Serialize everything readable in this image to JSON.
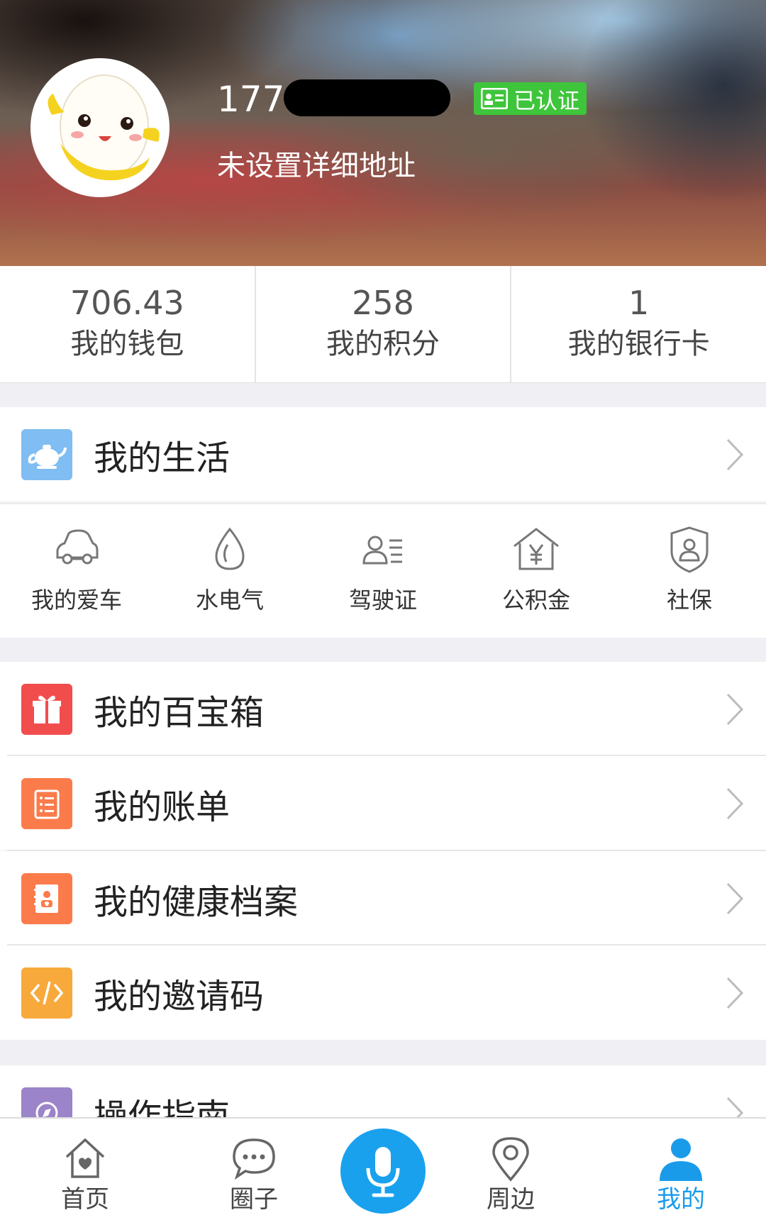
{
  "profile": {
    "phone_prefix": "177",
    "verified_label": "已认证",
    "address": "未设置详细地址"
  },
  "stats": [
    {
      "value": "706.43",
      "label": "我的钱包"
    },
    {
      "value": "258",
      "label": "我的积分"
    },
    {
      "value": "1",
      "label": "我的银行卡"
    }
  ],
  "life": {
    "title": "我的生活",
    "items": [
      {
        "label": "我的爱车",
        "icon": "car-icon"
      },
      {
        "label": "水电气",
        "icon": "water-drop-icon"
      },
      {
        "label": "驾驶证",
        "icon": "license-icon"
      },
      {
        "label": "公积金",
        "icon": "fund-house-icon"
      },
      {
        "label": "社保",
        "icon": "social-security-icon"
      }
    ]
  },
  "menu": [
    {
      "label": "我的百宝箱",
      "icon": "gift-icon",
      "color": "#f24d4d"
    },
    {
      "label": "我的账单",
      "icon": "bill-list-icon",
      "color": "#fb7b4b"
    },
    {
      "label": "我的健康档案",
      "icon": "health-record-icon",
      "color": "#fb7b4b"
    },
    {
      "label": "我的邀请码",
      "icon": "code-icon",
      "color": "#f7a93b"
    },
    {
      "label": "操作指南",
      "icon": "guide-icon",
      "color": "#9b84c9"
    }
  ],
  "colors": {
    "life_icon_bg": "#7fbdf2",
    "accent": "#1aa1ee",
    "verified_bg": "#3fc53b"
  },
  "tabbar": {
    "items": [
      {
        "label": "首页",
        "icon": "home-icon"
      },
      {
        "label": "圈子",
        "icon": "chat-bubble-icon"
      },
      {
        "label": "",
        "icon": "microphone-icon"
      },
      {
        "label": "周边",
        "icon": "location-pin-icon"
      },
      {
        "label": "我的",
        "icon": "user-icon",
        "active": true
      }
    ]
  }
}
